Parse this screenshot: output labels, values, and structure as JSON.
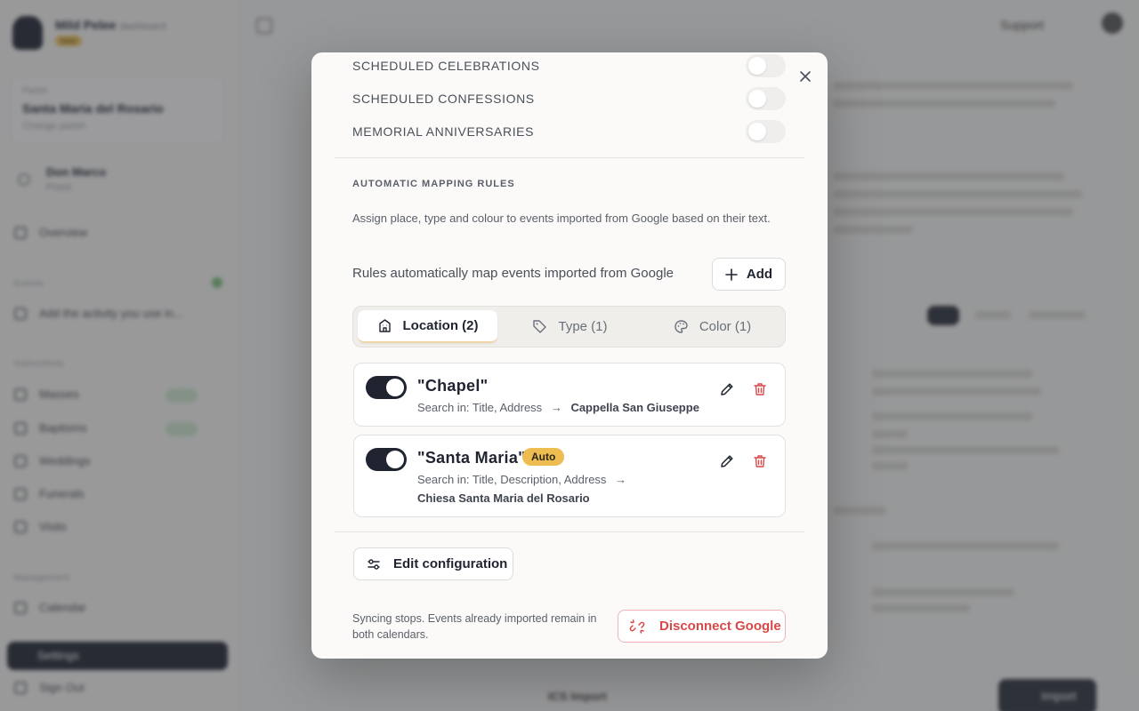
{
  "background": {
    "brand_name": "Mild Pelee",
    "brand_sub": "dashboard",
    "brand_badge": "beta",
    "parish_label": "Parish",
    "parish_name": "Santa Maria del Rosario",
    "parish_sub": "Change parish",
    "user_name": "Don Marco",
    "user_role": "Priest",
    "nav_overview": "Overview",
    "section_events": "Events",
    "nav_quick_add": "Add the activity you use in...",
    "section_instructions": "Instructions",
    "nav_instructions": [
      "Masses",
      "Baptisms",
      "Weddings",
      "Funerals",
      "Visits"
    ],
    "section_management": "Management",
    "nav_calendar": "Calendar",
    "nav_settings": "Settings",
    "nav_sign_out": "Sign Out",
    "top_support": "Support",
    "bottom_label": "ICS Import",
    "bottom_btn": "Import"
  },
  "modal": {
    "settings": [
      {
        "label": "SCHEDULED CELEBRATIONS",
        "enabled": false
      },
      {
        "label": "SCHEDULED CONFESSIONS",
        "enabled": false
      },
      {
        "label": "MEMORIAL ANNIVERSARIES",
        "enabled": false
      }
    ],
    "mapping_title": "AUTOMATIC MAPPING RULES",
    "mapping_desc": "Assign place, type and colour to events imported from Google based on their text.",
    "rules_note": "Rules automatically map events imported from Google",
    "add_label": "Add",
    "tabs": [
      {
        "label": "Location (2)",
        "icon": "building-icon",
        "active": true
      },
      {
        "label": "Type (1)",
        "icon": "tag-icon",
        "active": false
      },
      {
        "label": "Color (1)",
        "icon": "palette-icon",
        "active": false
      }
    ],
    "rules": [
      {
        "term": "\"Chapel\"",
        "enabled": true,
        "search_in": "Search in: Title, Address",
        "target": "Cappella San Giuseppe",
        "badge": ""
      },
      {
        "term": "\"Santa Maria\"",
        "enabled": true,
        "search_in": "Search in: Title, Description, Address",
        "target": "Chiesa Santa Maria del Rosario",
        "badge": "Auto"
      }
    ],
    "arrow": "→",
    "edit_config_label": "Edit configuration",
    "sync_note": "Syncing stops. Events already imported remain in both calendars.",
    "disconnect_label": "Disconnect Google",
    "colors": {
      "accent_dark": "#1f2430",
      "danger": "#d94848",
      "auto_badge": "#eebd52"
    }
  }
}
